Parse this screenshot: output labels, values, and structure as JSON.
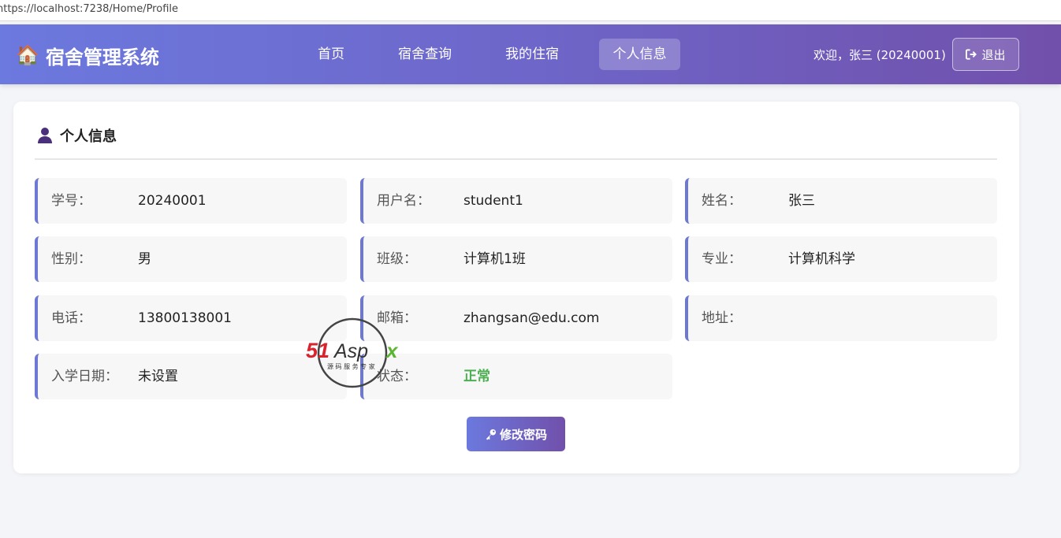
{
  "browser": {
    "url": "https://localhost:7238/Home/Profile"
  },
  "navbar": {
    "brand_icon": "🏠",
    "brand": "宿舍管理系统",
    "links": [
      {
        "label": "首页",
        "active": false
      },
      {
        "label": "宿舍查询",
        "active": false
      },
      {
        "label": "我的住宿",
        "active": false
      },
      {
        "label": "个人信息",
        "active": true
      }
    ],
    "welcome": "欢迎，张三 (20240001)",
    "logout_label": "退出"
  },
  "profile": {
    "title": "个人信息",
    "fields": [
      {
        "label": "学号：",
        "value": "20240001"
      },
      {
        "label": "用户名：",
        "value": "student1"
      },
      {
        "label": "姓名：",
        "value": "张三"
      },
      {
        "label": "性别：",
        "value": "男"
      },
      {
        "label": "班级：",
        "value": "计算机1班"
      },
      {
        "label": "专业：",
        "value": "计算机科学"
      },
      {
        "label": "电话：",
        "value": "13800138001"
      },
      {
        "label": "邮箱：",
        "value": "zhangsan@edu.com"
      },
      {
        "label": "地址：",
        "value": ""
      },
      {
        "label": "入学日期：",
        "value": "未设置"
      },
      {
        "label": "状态：",
        "value": "正常"
      }
    ],
    "change_password_label": "修改密码"
  },
  "watermark": {
    "brand": "51Aspx",
    "tagline": "源码服务专家"
  },
  "colors": {
    "accent": "#6c79de",
    "accent_dark": "#7150ab",
    "status_ok": "#4caf50"
  }
}
